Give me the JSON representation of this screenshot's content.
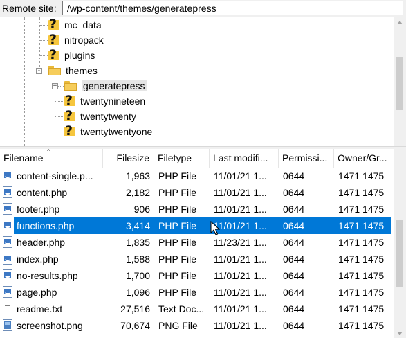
{
  "site_bar": {
    "label": "Remote site:",
    "path": "/wp-content/themes/generatepress"
  },
  "tree": {
    "items": [
      {
        "label": "mc_data",
        "icon": "question-folder-icon"
      },
      {
        "label": "nitropack",
        "icon": "question-folder-icon"
      },
      {
        "label": "plugins",
        "icon": "question-folder-icon"
      },
      {
        "label": "themes",
        "icon": "folder-icon",
        "expander": "-"
      },
      {
        "label": "generatepress",
        "icon": "folder-icon",
        "expander": "+",
        "selected": true
      },
      {
        "label": "twentynineteen",
        "icon": "question-folder-icon"
      },
      {
        "label": "twentytwenty",
        "icon": "question-folder-icon"
      },
      {
        "label": "twentytwentyone",
        "icon": "question-folder-icon"
      }
    ]
  },
  "table": {
    "columns": [
      "Filename",
      "Filesize",
      "Filetype",
      "Last modifi...",
      "Permissi...",
      "Owner/Gr..."
    ],
    "rows": [
      {
        "name": "content-single.p...",
        "size": "1,963",
        "type": "PHP File",
        "modified": "11/01/21 1...",
        "perms": "0644",
        "owner": "1471 1475",
        "icon": "php-file-icon"
      },
      {
        "name": "content.php",
        "size": "2,182",
        "type": "PHP File",
        "modified": "11/01/21 1...",
        "perms": "0644",
        "owner": "1471 1475",
        "icon": "php-file-icon"
      },
      {
        "name": "footer.php",
        "size": "906",
        "type": "PHP File",
        "modified": "11/01/21 1...",
        "perms": "0644",
        "owner": "1471 1475",
        "icon": "php-file-icon"
      },
      {
        "name": "functions.php",
        "size": "3,414",
        "type": "PHP File",
        "modified": "11/01/21 1...",
        "perms": "0644",
        "owner": "1471 1475",
        "icon": "php-file-icon",
        "selected": true
      },
      {
        "name": "header.php",
        "size": "1,835",
        "type": "PHP File",
        "modified": "11/23/21 1...",
        "perms": "0644",
        "owner": "1471 1475",
        "icon": "php-file-icon"
      },
      {
        "name": "index.php",
        "size": "1,588",
        "type": "PHP File",
        "modified": "11/01/21 1...",
        "perms": "0644",
        "owner": "1471 1475",
        "icon": "php-file-icon"
      },
      {
        "name": "no-results.php",
        "size": "1,700",
        "type": "PHP File",
        "modified": "11/01/21 1...",
        "perms": "0644",
        "owner": "1471 1475",
        "icon": "php-file-icon"
      },
      {
        "name": "page.php",
        "size": "1,096",
        "type": "PHP File",
        "modified": "11/01/21 1...",
        "perms": "0644",
        "owner": "1471 1475",
        "icon": "php-file-icon"
      },
      {
        "name": "readme.txt",
        "size": "27,516",
        "type": "Text Doc...",
        "modified": "11/01/21 1...",
        "perms": "0644",
        "owner": "1471 1475",
        "icon": "text-file-icon"
      },
      {
        "name": "screenshot.png",
        "size": "70,674",
        "type": "PNG File",
        "modified": "11/01/21 1...",
        "perms": "0644",
        "owner": "1471 1475",
        "icon": "png-file-icon"
      }
    ]
  },
  "colors": {
    "selection": "#0078d7",
    "folder": "#f6cd5b",
    "question_bg": "#f6c63d"
  }
}
